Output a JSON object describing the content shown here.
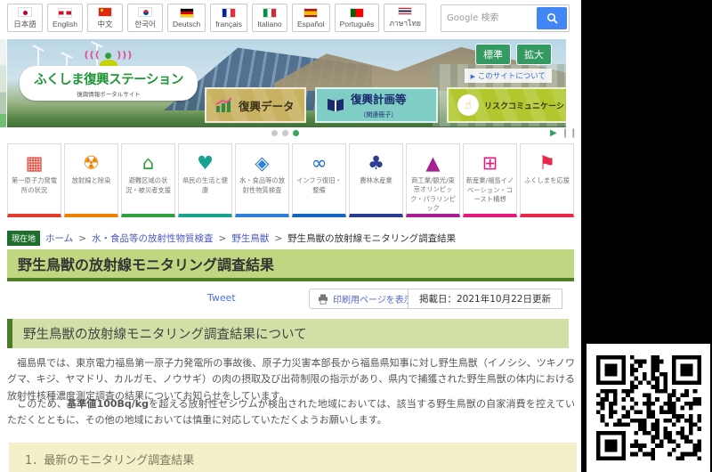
{
  "topbar": {
    "languages": [
      {
        "label": "日本語",
        "flag": "japan"
      },
      {
        "label": "English",
        "flag": "uk"
      },
      {
        "label": "中文",
        "flag": "china"
      },
      {
        "label": "한국어",
        "flag": "korea"
      },
      {
        "label": "Deutsch",
        "flag": "germany"
      },
      {
        "label": "français",
        "flag": "france"
      },
      {
        "label": "Italiano",
        "flag": "italy"
      },
      {
        "label": "Español",
        "flag": "spain"
      },
      {
        "label": "Português",
        "flag": "portugal"
      },
      {
        "label": "ภาษาไทย",
        "flag": "thailand"
      }
    ],
    "search_placeholder": "Google 検索"
  },
  "hero": {
    "logo_title": "ふくしま復興ステーション",
    "logo_subtitle": "復興情報ポータルサイト",
    "size_standard": "標準",
    "size_large": "拡大",
    "about_link": "このサイトについて",
    "banners": [
      {
        "label": "復興データ"
      },
      {
        "label": "復興計画等",
        "sublabel": "（関連冊子）"
      },
      {
        "label": "リスクコミュニケーション"
      }
    ]
  },
  "carousel": {
    "dot_count": 3,
    "active_dot": 3
  },
  "nav_tiles": [
    {
      "label": "第一原子力発電所の状況",
      "glyph": "▦",
      "color": "#e23d2d"
    },
    {
      "label": "放射線と除染",
      "glyph": "☢",
      "color": "#ef8200"
    },
    {
      "label": "避難区域の状況・被災者支援",
      "glyph": "⌂",
      "color": "#31a043"
    },
    {
      "label": "県民の生活と健康",
      "glyph": "♥",
      "color": "#17a292"
    },
    {
      "label": "水・食品等の放射性物質検査",
      "glyph": "◈",
      "color": "#2f7fd6"
    },
    {
      "label": "インフラ復旧・整備",
      "glyph": "∞",
      "color": "#1467c0"
    },
    {
      "label": "農林水産業",
      "glyph": "♣",
      "color": "#2c3e92"
    },
    {
      "label": "商工業/観光/東京オリンピック・パラリンピック",
      "glyph": "▲",
      "color": "#a7208f"
    },
    {
      "label": "新産業/福島イノベーション・コースト構想",
      "glyph": "⊞",
      "color": "#e6187e"
    },
    {
      "label": "ふくしまを応援",
      "glyph": "⚑",
      "color": "#e8274b"
    }
  ],
  "breadcrumb": {
    "badge": "現在地",
    "home": "ホーム",
    "level1": "水・食品等の放射性物質検査",
    "level2": "野生鳥獣",
    "current": "野生鳥獣の放射線モニタリング調査結果"
  },
  "article": {
    "title": "野生鳥獣の放射線モニタリング調査結果",
    "tweet_label": "Tweet",
    "print_label": "印刷用ページを表示する",
    "date_label": "掲載日：2021年10月22日更新",
    "section_heading": "野生鳥獣の放射線モニタリング調査結果について",
    "paragraph1": "　福島県では、東京電力福島第一原子力発電所の事故後、原子力災害本部長から福島県知事に対し野生鳥獣（イノシシ、ツキノワグマ、キジ、ヤマドリ、カルガモ、ノウサギ）の肉の摂取及び出荷制限の指示があり、県内で捕獲された野生鳥獣の体内における放射性核種濃度測定調査の結果についてお知らせをしています。",
    "paragraph2_pre": "　このため、",
    "paragraph2_bold": "基準値100Bq/kg",
    "paragraph2_post": "を超える放射性セシウムが検出された地域においては、該当する野生鳥獣の自家消費を控えていただくとともに、その他の地域においては慎重に対応していただくようお願いします。",
    "sub_heading": "1．最新のモニタリング調査結果"
  },
  "colors": {
    "title_bar_bg": "#bed780",
    "title_bar_border": "#4e7f26",
    "section_heading_bg": "#d1e0a6",
    "sub_heading_bg": "#f3f1c9",
    "badge_green": "#1e6f2e",
    "link_blue": "#4a5bbf",
    "button_green": "#349a62",
    "google_blue": "#4285f4"
  }
}
